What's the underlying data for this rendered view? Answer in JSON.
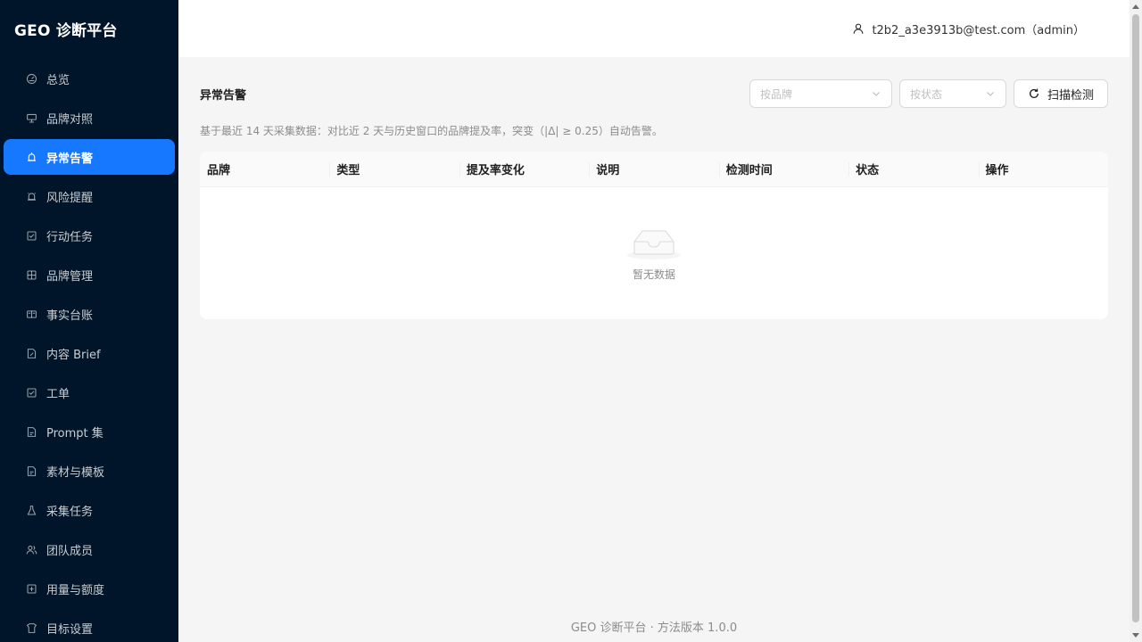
{
  "app": {
    "title": "GEO 诊断平台"
  },
  "sidebar": {
    "items": [
      {
        "label": "总览",
        "icon": "dashboard-icon"
      },
      {
        "label": "品牌对照",
        "icon": "compare-icon"
      },
      {
        "label": "异常告警",
        "icon": "alert-icon",
        "active": true
      },
      {
        "label": "风险提醒",
        "icon": "bell-icon"
      },
      {
        "label": "行动任务",
        "icon": "check-square-icon"
      },
      {
        "label": "品牌管理",
        "icon": "table-icon"
      },
      {
        "label": "事实台账",
        "icon": "book-icon"
      },
      {
        "label": "内容 Brief",
        "icon": "file-edit-icon"
      },
      {
        "label": "工单",
        "icon": "check-square-icon"
      },
      {
        "label": "Prompt 集",
        "icon": "file-icon"
      },
      {
        "label": "素材与模板",
        "icon": "file-icon"
      },
      {
        "label": "采集任务",
        "icon": "beaker-icon"
      },
      {
        "label": "团队成员",
        "icon": "team-icon"
      },
      {
        "label": "用量与额度",
        "icon": "usage-icon"
      },
      {
        "label": "目标设置",
        "icon": "target-icon"
      }
    ]
  },
  "header": {
    "user": "t2b2_a3e3913b@test.com（admin）"
  },
  "main": {
    "title": "异常告警",
    "brand_filter_placeholder": "按品牌",
    "status_filter_placeholder": "按状态",
    "scan_button": "扫描检测",
    "description": "基于最近 14 天采集数据：对比近 2 天与历史窗口的品牌提及率，突变（|Δ| ≥ 0.25）自动告警。",
    "table": {
      "columns": [
        "品牌",
        "类型",
        "提及率变化",
        "说明",
        "检测时间",
        "状态",
        "操作"
      ],
      "rows": [],
      "empty_text": "暂无数据"
    }
  },
  "footer": {
    "text": "GEO 诊断平台 · 方法版本 1.0.0"
  },
  "colors": {
    "sidebar_bg": "#001529",
    "accent": "#1677ff",
    "page_bg": "#f5f5f5"
  }
}
